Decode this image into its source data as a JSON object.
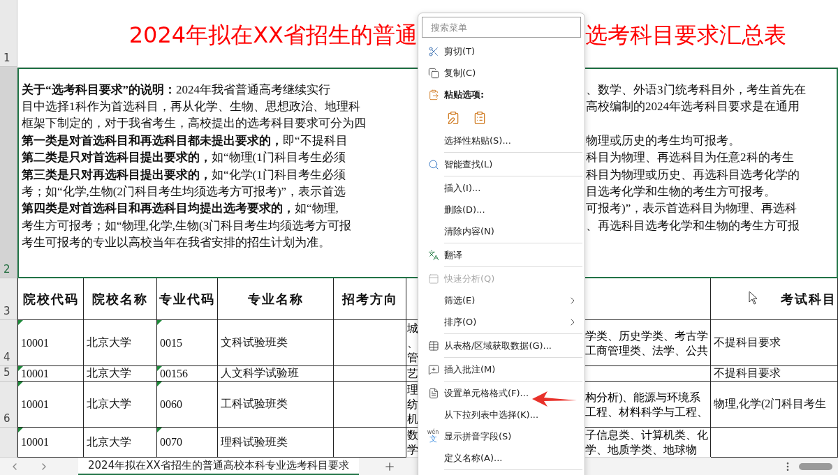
{
  "title_row": {
    "number": "1",
    "left": "2024年拟在XX省招生的普通",
    "right": "选考科目要求汇总表"
  },
  "description": {
    "number": "2",
    "selected": true,
    "lines": [
      {
        "left": "**关于“选考科目要求”的说明：**2024年我省普通高考继续实行",
        "right": "、数学、外语3门统考科目外，考生首先在"
      },
      {
        "left": "目中选择1科作为首选科目，再从化学、生物、思想政治、地理科",
        "right": "高校编制的2024年选考科目要求是在通用"
      },
      {
        "left": "框架下制定的，对于我省考生，高校提出的选考科目要求可分为四"
      },
      {
        "left": "**第一类是对首选科目和再选科目都未提出要求的，**即“不提科目",
        "right": "物理或历史的考生均可报考。"
      },
      {
        "left": "**第二类是只对首选科目提出要求的，**如“物理(1门科目考生必须",
        "right": "科目为物理、再选科目为任意2科的考生"
      },
      {
        "left": "**第三类是只对再选科目提出要求的，**如“化学(1门科目考生必须",
        "right": "科目为物理或历史、再选科目选考化学的"
      },
      {
        "left": "考；如“化学,生物(2门科目考生均须选考方可报考)”，表示首选",
        "right": "目选考化学和生物的考生方可报考。"
      },
      {
        "left": "**第四类是对首选科目和再选科目均提出选考要求的，**如“物理,",
        "right": "可报考)”，表示首选科目为物理、再选科"
      },
      {
        "left": "考生方可报考；如“物理,化学,生物(3门科目考生均须选考方可报",
        "right": "、再选科目选考化学和生物的考生方可报"
      },
      {
        "left": "考生可报考的专业以高校当年在我省安排的招生计划为准。"
      }
    ]
  },
  "table": {
    "header": {
      "number": "3",
      "columns": [
        "院校代码",
        "院校名称",
        "专业代码",
        "专业名称",
        "招考方向"
      ],
      "column_7": "考试科目"
    },
    "rows": [
      {
        "number": "4",
        "cells": [
          {
            "text": "10001",
            "flagged": true
          },
          {
            "text": "北京大学",
            "flagged": false
          },
          {
            "text": "0015",
            "flagged": true
          },
          {
            "text": "文科试验班类",
            "flagged": false
          }
        ],
        "column_6_left": [
          "城",
          "、",
          "管"
        ],
        "column_6_right": [
          "学类、历史学类、考古学",
          "工商管理类、法学、公共"
        ],
        "column_7": "不提科目要求"
      },
      {
        "number": "5",
        "cells": [
          {
            "text": "10001",
            "flagged": true
          },
          {
            "text": "北京大学",
            "flagged": false
          },
          {
            "text": "00156",
            "flagged": true
          },
          {
            "text": "人文科学试验班",
            "flagged": false
          }
        ],
        "column_6_left": [
          "艺"
        ],
        "column_7": "不提科目要求"
      },
      {
        "number": "6",
        "cells": [
          {
            "text": "10001",
            "flagged": true
          },
          {
            "text": "北京大学",
            "flagged": false
          },
          {
            "text": "0060",
            "flagged": true
          },
          {
            "text": "工科试验班类",
            "flagged": false
          }
        ],
        "column_6_left": [
          "理",
          "纺",
          "机"
        ],
        "column_6_right": [
          "构分析)、能源与环境系",
          "工程、材料科学与工程、"
        ],
        "column_7": "物理,化学(2门科目考生"
      },
      {
        "cells": [
          {
            "text": "10001",
            "flagged": true
          },
          {
            "text": "北京大学",
            "flagged": false
          },
          {
            "text": "0070",
            "flagged": true
          },
          {
            "text": "理科试验班类",
            "flagged": false
          }
        ],
        "column_6_left": [
          "数",
          "学"
        ],
        "column_6_right": [
          "子信息类、计算机类、化",
          "学、地质学类、地球物"
        ]
      }
    ]
  },
  "context_menu": {
    "search_placeholder": "搜索菜单",
    "items": [
      {
        "kind": "cut",
        "label": "剪切(T)",
        "disabled": false
      },
      {
        "kind": "copy",
        "label": "复制(C)",
        "disabled": false
      },
      {
        "kind": "paste-header",
        "label": "粘贴选项:",
        "disabled": false
      },
      {
        "kind": "paste-options"
      },
      {
        "kind": "plain",
        "label": "选择性粘贴(S)...",
        "disabled": false
      },
      {
        "kind": "separator"
      },
      {
        "kind": "lookup",
        "label": "智能查找(L)",
        "disabled": false
      },
      {
        "kind": "separator"
      },
      {
        "kind": "plain",
        "label": "插入(I)...",
        "disabled": false
      },
      {
        "kind": "plain",
        "label": "删除(D)...",
        "disabled": false
      },
      {
        "kind": "plain",
        "label": "清除内容(N)",
        "disabled": false
      },
      {
        "kind": "separator"
      },
      {
        "kind": "translate",
        "label": "翻译",
        "disabled": false
      },
      {
        "kind": "separator"
      },
      {
        "kind": "analysis",
        "label": "快速分析(Q)",
        "disabled": true
      },
      {
        "kind": "submenu",
        "label": "筛选(E)",
        "disabled": false
      },
      {
        "kind": "submenu",
        "label": "排序(O)",
        "disabled": false
      },
      {
        "kind": "separator"
      },
      {
        "kind": "table",
        "label": "从表格/区域获取数据(G)...",
        "disabled": false
      },
      {
        "kind": "separator"
      },
      {
        "kind": "comment",
        "label": "插入批注(M)",
        "disabled": false
      },
      {
        "kind": "separator"
      },
      {
        "kind": "format",
        "label": "设置单元格格式(F)...",
        "disabled": false
      },
      {
        "kind": "plain",
        "label": "从下拉列表中选择(K)...",
        "disabled": false
      },
      {
        "kind": "pinyin",
        "label": "显示拼音字段(S)",
        "icon_top": "wén",
        "icon_bottom": "文",
        "disabled": false
      },
      {
        "kind": "plain",
        "label": "定义名称(A)...",
        "disabled": false
      },
      {
        "kind": "separator"
      }
    ]
  },
  "sheet_tabs": [
    {
      "label": "2024年拟在XX省招生的普通高校本科专业选考科目要求",
      "selected": true
    }
  ]
}
